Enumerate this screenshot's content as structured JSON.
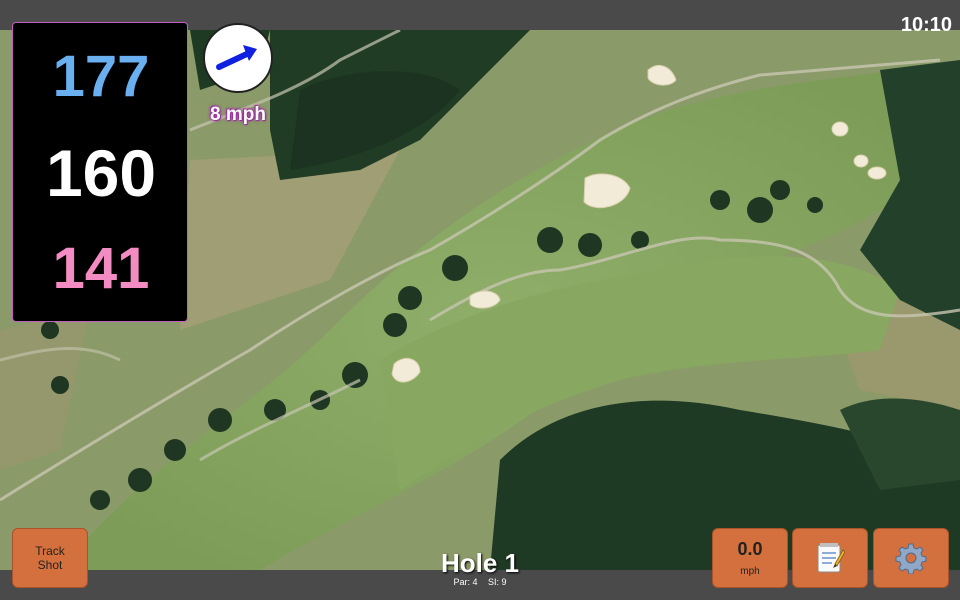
{
  "status": {
    "time": "10:10"
  },
  "distances": {
    "back": "177",
    "middle": "160",
    "front": "141",
    "colors": {
      "back": "#6ab0f0",
      "middle": "#ffffff",
      "front": "#f48cc4"
    }
  },
  "wind": {
    "speed_label": "8 mph",
    "arrow_icon": "wind-direction-arrow-icon",
    "arrow_color": "#1020e0"
  },
  "hole": {
    "title": "Hole 1",
    "par": "Par: 4",
    "si": "SI: 9"
  },
  "buttons": {
    "track_shot": "Track Shot",
    "speed_value": "0.0",
    "speed_unit": "mph",
    "notes_icon": "notepad-icon",
    "settings_icon": "gear-icon",
    "button_color": "#d4703d"
  },
  "map": {
    "type": "satellite-golf-hole-view"
  }
}
